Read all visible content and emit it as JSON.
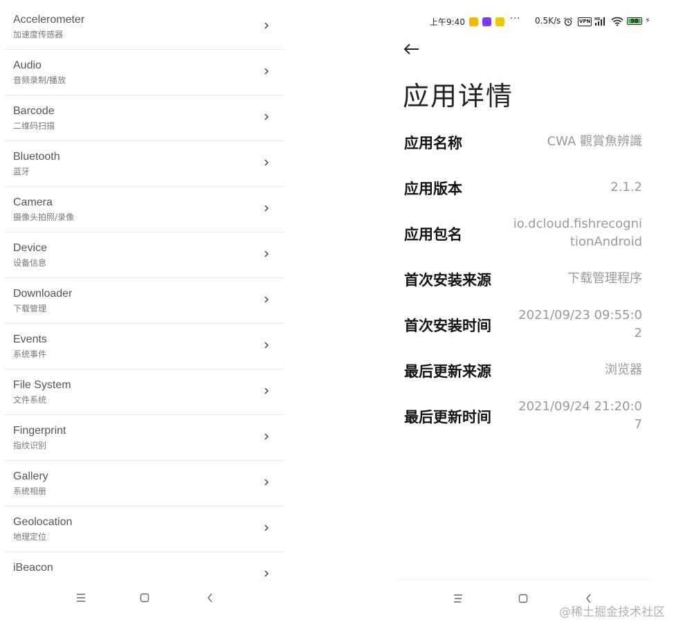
{
  "api_list": [
    {
      "title": "Accelerometer",
      "subtitle": "加速度传感器"
    },
    {
      "title": "Audio",
      "subtitle": "音频录制/播放"
    },
    {
      "title": "Barcode",
      "subtitle": "二维码扫描"
    },
    {
      "title": "Bluetooth",
      "subtitle": "蓝牙"
    },
    {
      "title": "Camera",
      "subtitle": "摄像头拍照/录像"
    },
    {
      "title": "Device",
      "subtitle": "设备信息"
    },
    {
      "title": "Downloader",
      "subtitle": "下载管理"
    },
    {
      "title": "Events",
      "subtitle": "系统事件"
    },
    {
      "title": "File System",
      "subtitle": "文件系统"
    },
    {
      "title": "Fingerprint",
      "subtitle": "指纹识别"
    },
    {
      "title": "Gallery",
      "subtitle": "系统相册"
    },
    {
      "title": "Geolocation",
      "subtitle": "地理定位"
    },
    {
      "title": "iBeacon",
      "subtitle": ""
    }
  ],
  "status_bar": {
    "time": "上午9:40",
    "dots": "···",
    "net_speed": "0.5K/s",
    "vpn_label": "VPN",
    "signal_label": "HD",
    "battery_level": "98",
    "app_icon_colors": [
      "#f7b500",
      "#7a3cff",
      "#f5c400"
    ]
  },
  "detail_page": {
    "title": "应用详情",
    "rows": [
      {
        "label": "应用名称",
        "value": "CWA 觀賞魚辨識"
      },
      {
        "label": "应用版本",
        "value": "2.1.2"
      },
      {
        "label": "应用包名",
        "value": "io.dcloud.fishrecognitionAndroid"
      },
      {
        "label": "首次安装来源",
        "value": "下载管理程序"
      },
      {
        "label": "首次安装时间",
        "value": "2021/09/23 09:55:02"
      },
      {
        "label": "最后更新来源",
        "value": "浏览器"
      },
      {
        "label": "最后更新时间",
        "value": "2021/09/24 21:20:07"
      }
    ]
  },
  "navigation": {
    "left": [
      "menu-icon",
      "home-icon",
      "back-icon"
    ],
    "right": [
      "menu-icon",
      "home-icon",
      "back-icon"
    ]
  },
  "watermark": "@稀土掘金技术社区",
  "colors": {
    "title_text": "#555555",
    "subtitle_text": "#777777",
    "value_text": "#999999",
    "label_text": "#111111",
    "battery_fill": "#3cc43c"
  }
}
